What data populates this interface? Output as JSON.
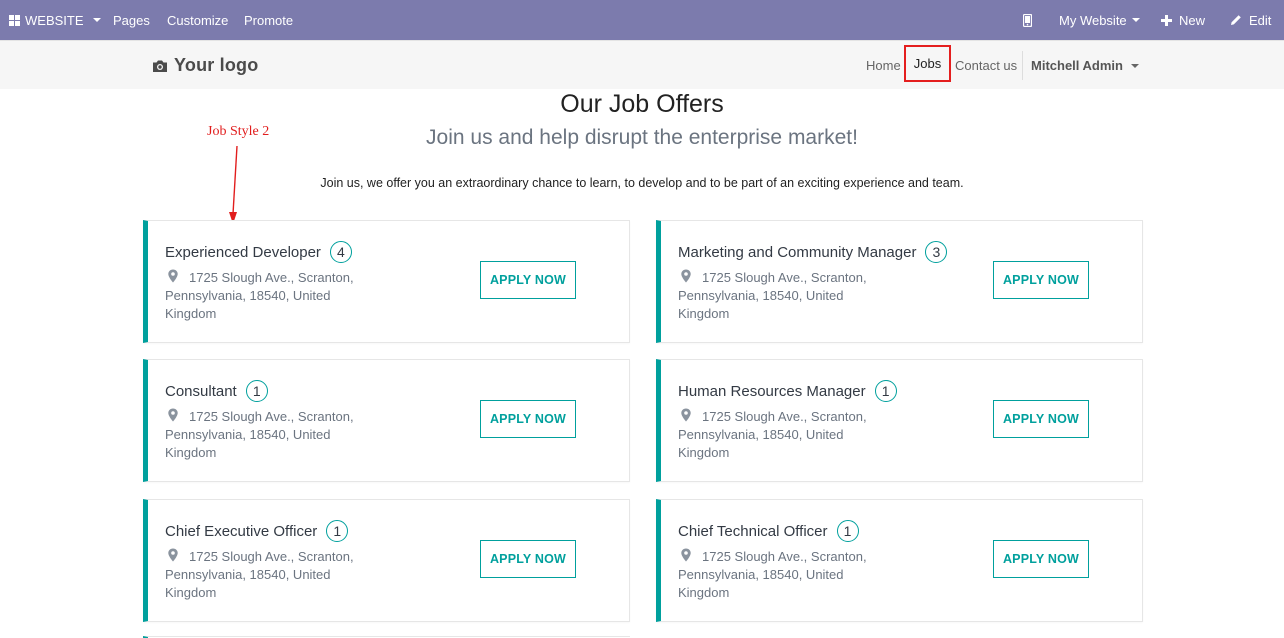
{
  "adminbar": {
    "website_menu": "WEBSITE",
    "pages": "Pages",
    "customize": "Customize",
    "promote": "Promote",
    "my_website": "My Website",
    "new": "New",
    "edit": "Edit"
  },
  "header": {
    "logo_text": "Your logo",
    "nav": {
      "home": "Home",
      "jobs": "Jobs",
      "contact": "Contact us",
      "user": "Mitchell Admin"
    }
  },
  "hero": {
    "title": "Our Job Offers",
    "subtitle": "Join us and help disrupt the enterprise market!",
    "intro": "Join us, we offer you an extraordinary chance to learn, to develop and to be part of an exciting experience and team."
  },
  "annotation": {
    "label": "Job Style 2"
  },
  "jobs": [
    {
      "title": "Experienced Developer",
      "count": "4",
      "address": "1725 Slough Ave., Scranton, Pennsylvania, 18540, United Kingdom",
      "apply": "APPLY NOW"
    },
    {
      "title": "Marketing and Community Manager",
      "count": "3",
      "address": "1725 Slough Ave., Scranton, Pennsylvania, 18540, United Kingdom",
      "apply": "APPLY NOW"
    },
    {
      "title": "Consultant",
      "count": "1",
      "address": "1725 Slough Ave., Scranton, Pennsylvania, 18540, United Kingdom",
      "apply": "APPLY NOW"
    },
    {
      "title": "Human Resources Manager",
      "count": "1",
      "address": "1725 Slough Ave., Scranton, Pennsylvania, 18540, United Kingdom",
      "apply": "APPLY NOW"
    },
    {
      "title": "Chief Executive Officer",
      "count": "1",
      "address": "1725 Slough Ave., Scranton, Pennsylvania, 18540, United Kingdom",
      "apply": "APPLY NOW"
    },
    {
      "title": "Chief Technical Officer",
      "count": "1",
      "address": "1725 Slough Ave., Scranton, Pennsylvania, 18540, United Kingdom",
      "apply": "APPLY NOW"
    }
  ],
  "colors": {
    "adminbar": "#7c7bad",
    "accent": "#00a09d",
    "annotation": "#e11d1d"
  }
}
